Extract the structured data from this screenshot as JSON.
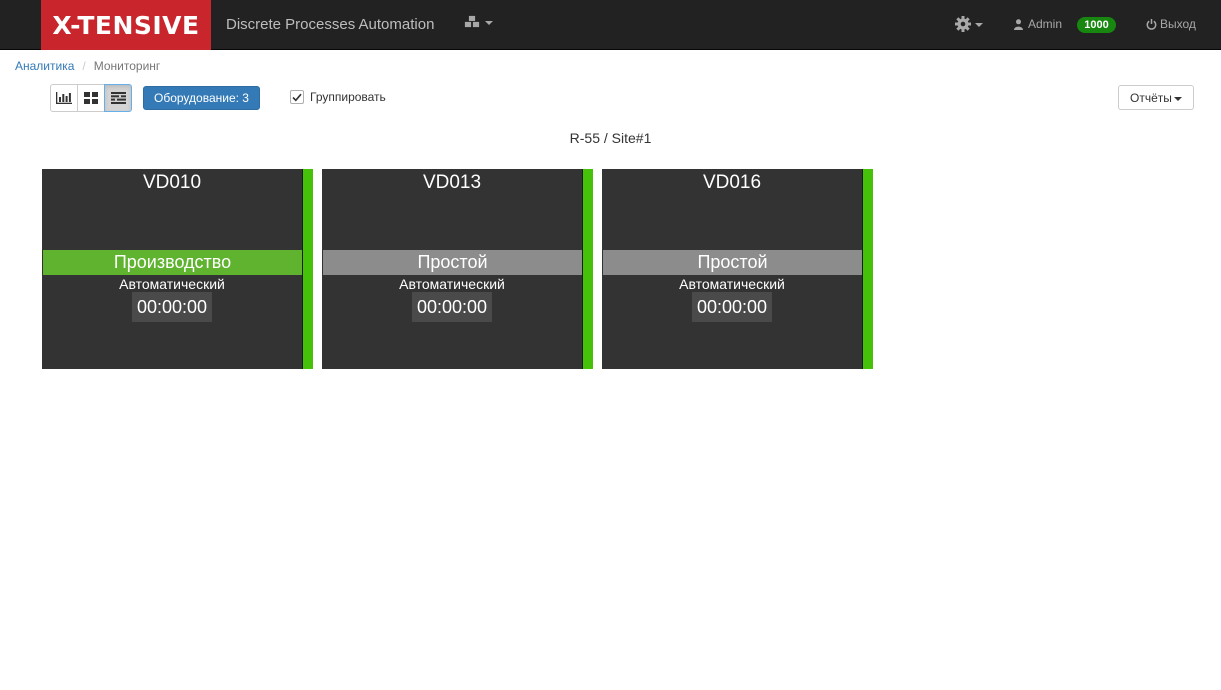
{
  "navbar": {
    "brand": "X-TENSIVE",
    "app_title": "Discrete Processes Automation",
    "user": "Admin",
    "badge": "1000",
    "logout": "Выход"
  },
  "breadcrumb": {
    "parent": "Аналитика",
    "current": "Мониторинг"
  },
  "toolbar": {
    "equipment_button": "Оборудование: 3",
    "group_label": "Группировать",
    "group_checked": true,
    "reports_label": "Отчёты"
  },
  "group_title": "R-55 / Site#1",
  "cards": [
    {
      "name": "VD010",
      "state": "Производство",
      "state_color": "#5fb32f",
      "mode": "Автоматический",
      "time": "00:00:00",
      "bar_color": "#44c108"
    },
    {
      "name": "VD013",
      "state": "Простой",
      "state_color": "#8c8c8c",
      "mode": "Автоматический",
      "time": "00:00:00",
      "bar_color": "#44c108"
    },
    {
      "name": "VD016",
      "state": "Простой",
      "state_color": "#8c8c8c",
      "mode": "Автоматический",
      "time": "00:00:00",
      "bar_color": "#44c108"
    }
  ],
  "colors": {
    "brand": "#c9252c",
    "navbar": "#222222",
    "primary": "#337ab7",
    "card_bg": "#333333"
  }
}
